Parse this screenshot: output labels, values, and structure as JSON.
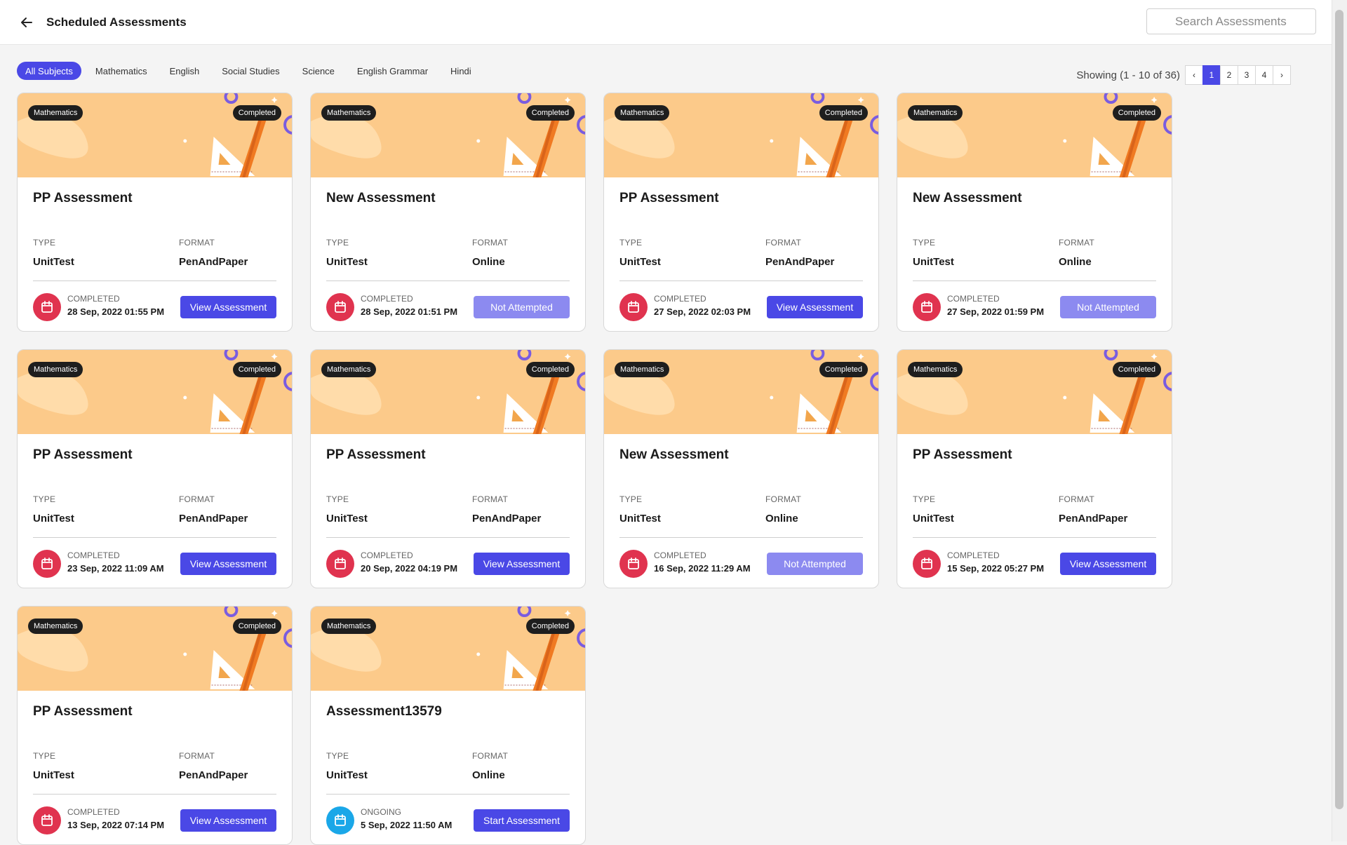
{
  "header": {
    "title": "Scheduled Assessments",
    "search_placeholder": "Search Assessments"
  },
  "filters": [
    {
      "label": "All Subjects",
      "active": true
    },
    {
      "label": "Mathematics",
      "active": false
    },
    {
      "label": "English",
      "active": false
    },
    {
      "label": "Social Studies",
      "active": false
    },
    {
      "label": "Science",
      "active": false
    },
    {
      "label": "English Grammar",
      "active": false
    },
    {
      "label": "Hindi",
      "active": false
    }
  ],
  "pagination": {
    "showing": "Showing (1 - 10 of 36)",
    "prev": "‹",
    "next": "›",
    "pages": [
      "1",
      "2",
      "3",
      "4"
    ],
    "current": "1"
  },
  "labels": {
    "type": "TYPE",
    "format": "FORMAT"
  },
  "colors": {
    "accent": "#4a48e6",
    "accent_muted": "#8c8af0",
    "banner": "#fcca8a",
    "completed_icon": "#e0334f",
    "ongoing_icon": "#1aa7e8"
  },
  "cards": [
    {
      "subject": "Mathematics",
      "status_badge": "Completed",
      "title": "PP Assessment",
      "type": "UnitTest",
      "format": "PenAndPaper",
      "state": "COMPLETED",
      "date": "28 Sep, 2022 01:55 PM",
      "action": "View Assessment",
      "action_style": "primary",
      "icon": "calendar-icon"
    },
    {
      "subject": "Mathematics",
      "status_badge": "Completed",
      "title": "New Assessment",
      "type": "UnitTest",
      "format": "Online",
      "state": "COMPLETED",
      "date": "28 Sep, 2022 01:51 PM",
      "action": "Not Attempted",
      "action_style": "muted",
      "icon": "calendar-icon"
    },
    {
      "subject": "Mathematics",
      "status_badge": "Completed",
      "title": "PP Assessment",
      "type": "UnitTest",
      "format": "PenAndPaper",
      "state": "COMPLETED",
      "date": "27 Sep, 2022 02:03 PM",
      "action": "View Assessment",
      "action_style": "primary",
      "icon": "calendar-icon"
    },
    {
      "subject": "Mathematics",
      "status_badge": "Completed",
      "title": "New Assessment",
      "type": "UnitTest",
      "format": "Online",
      "state": "COMPLETED",
      "date": "27 Sep, 2022 01:59 PM",
      "action": "Not Attempted",
      "action_style": "muted",
      "icon": "calendar-icon"
    },
    {
      "subject": "Mathematics",
      "status_badge": "Completed",
      "title": "PP Assessment",
      "type": "UnitTest",
      "format": "PenAndPaper",
      "state": "COMPLETED",
      "date": "23 Sep, 2022 11:09 AM",
      "action": "View Assessment",
      "action_style": "primary",
      "icon": "calendar-icon"
    },
    {
      "subject": "Mathematics",
      "status_badge": "Completed",
      "title": "PP Assessment",
      "type": "UnitTest",
      "format": "PenAndPaper",
      "state": "COMPLETED",
      "date": "20 Sep, 2022 04:19 PM",
      "action": "View Assessment",
      "action_style": "primary",
      "icon": "calendar-icon"
    },
    {
      "subject": "Mathematics",
      "status_badge": "Completed",
      "title": "New Assessment",
      "type": "UnitTest",
      "format": "Online",
      "state": "COMPLETED",
      "date": "16 Sep, 2022 11:29 AM",
      "action": "Not Attempted",
      "action_style": "muted",
      "icon": "calendar-icon"
    },
    {
      "subject": "Mathematics",
      "status_badge": "Completed",
      "title": "PP Assessment",
      "type": "UnitTest",
      "format": "PenAndPaper",
      "state": "COMPLETED",
      "date": "15 Sep, 2022 05:27 PM",
      "action": "View Assessment",
      "action_style": "primary",
      "icon": "calendar-icon"
    },
    {
      "subject": "Mathematics",
      "status_badge": "Completed",
      "title": "PP Assessment",
      "type": "UnitTest",
      "format": "PenAndPaper",
      "state": "COMPLETED",
      "date": "13 Sep, 2022 07:14 PM",
      "action": "View Assessment",
      "action_style": "primary",
      "icon": "calendar-icon"
    },
    {
      "subject": "Mathematics",
      "status_badge": "Completed",
      "title": "Assessment13579",
      "type": "UnitTest",
      "format": "Online",
      "state": "ONGOING",
      "date": "5 Sep, 2022 11:50 AM",
      "action": "Start Assessment",
      "action_style": "primary",
      "icon": "calendar-icon"
    }
  ]
}
